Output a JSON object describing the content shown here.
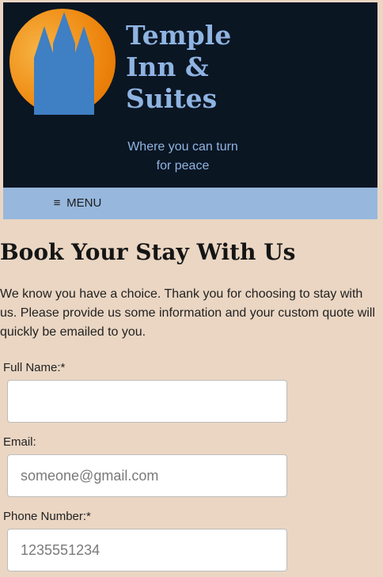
{
  "header": {
    "brand_lines": [
      "Temple",
      "Inn &",
      "Suites"
    ],
    "tagline": "Where you can turn for peace",
    "logo_name": "castle-logo",
    "colors": {
      "header_bg": "#0b1623",
      "brand_text": "#8fb4e2",
      "logo_sun": "#ee8a11",
      "logo_towers": "#3f7fc3"
    }
  },
  "nav": {
    "menu_icon": "hamburger-icon",
    "menu_icon_glyph": "≡",
    "menu_label": "MENU",
    "colors": {
      "nav_bg": "#97b7dd"
    }
  },
  "main": {
    "title": "Book Your Stay With Us",
    "intro": "We know you have a choice. Thank you for choosing to stay with us. Please provide us some information and your custom quote will quickly be emailed to you.",
    "form": {
      "fields": [
        {
          "label": "Full Name:*",
          "value": "",
          "placeholder": ""
        },
        {
          "label": "Email:",
          "value": "",
          "placeholder": "someone@gmail.com"
        },
        {
          "label": "Phone Number:*",
          "value": "",
          "placeholder": "1235551234"
        }
      ]
    },
    "colors": {
      "page_bg": "#ead6c3"
    }
  }
}
